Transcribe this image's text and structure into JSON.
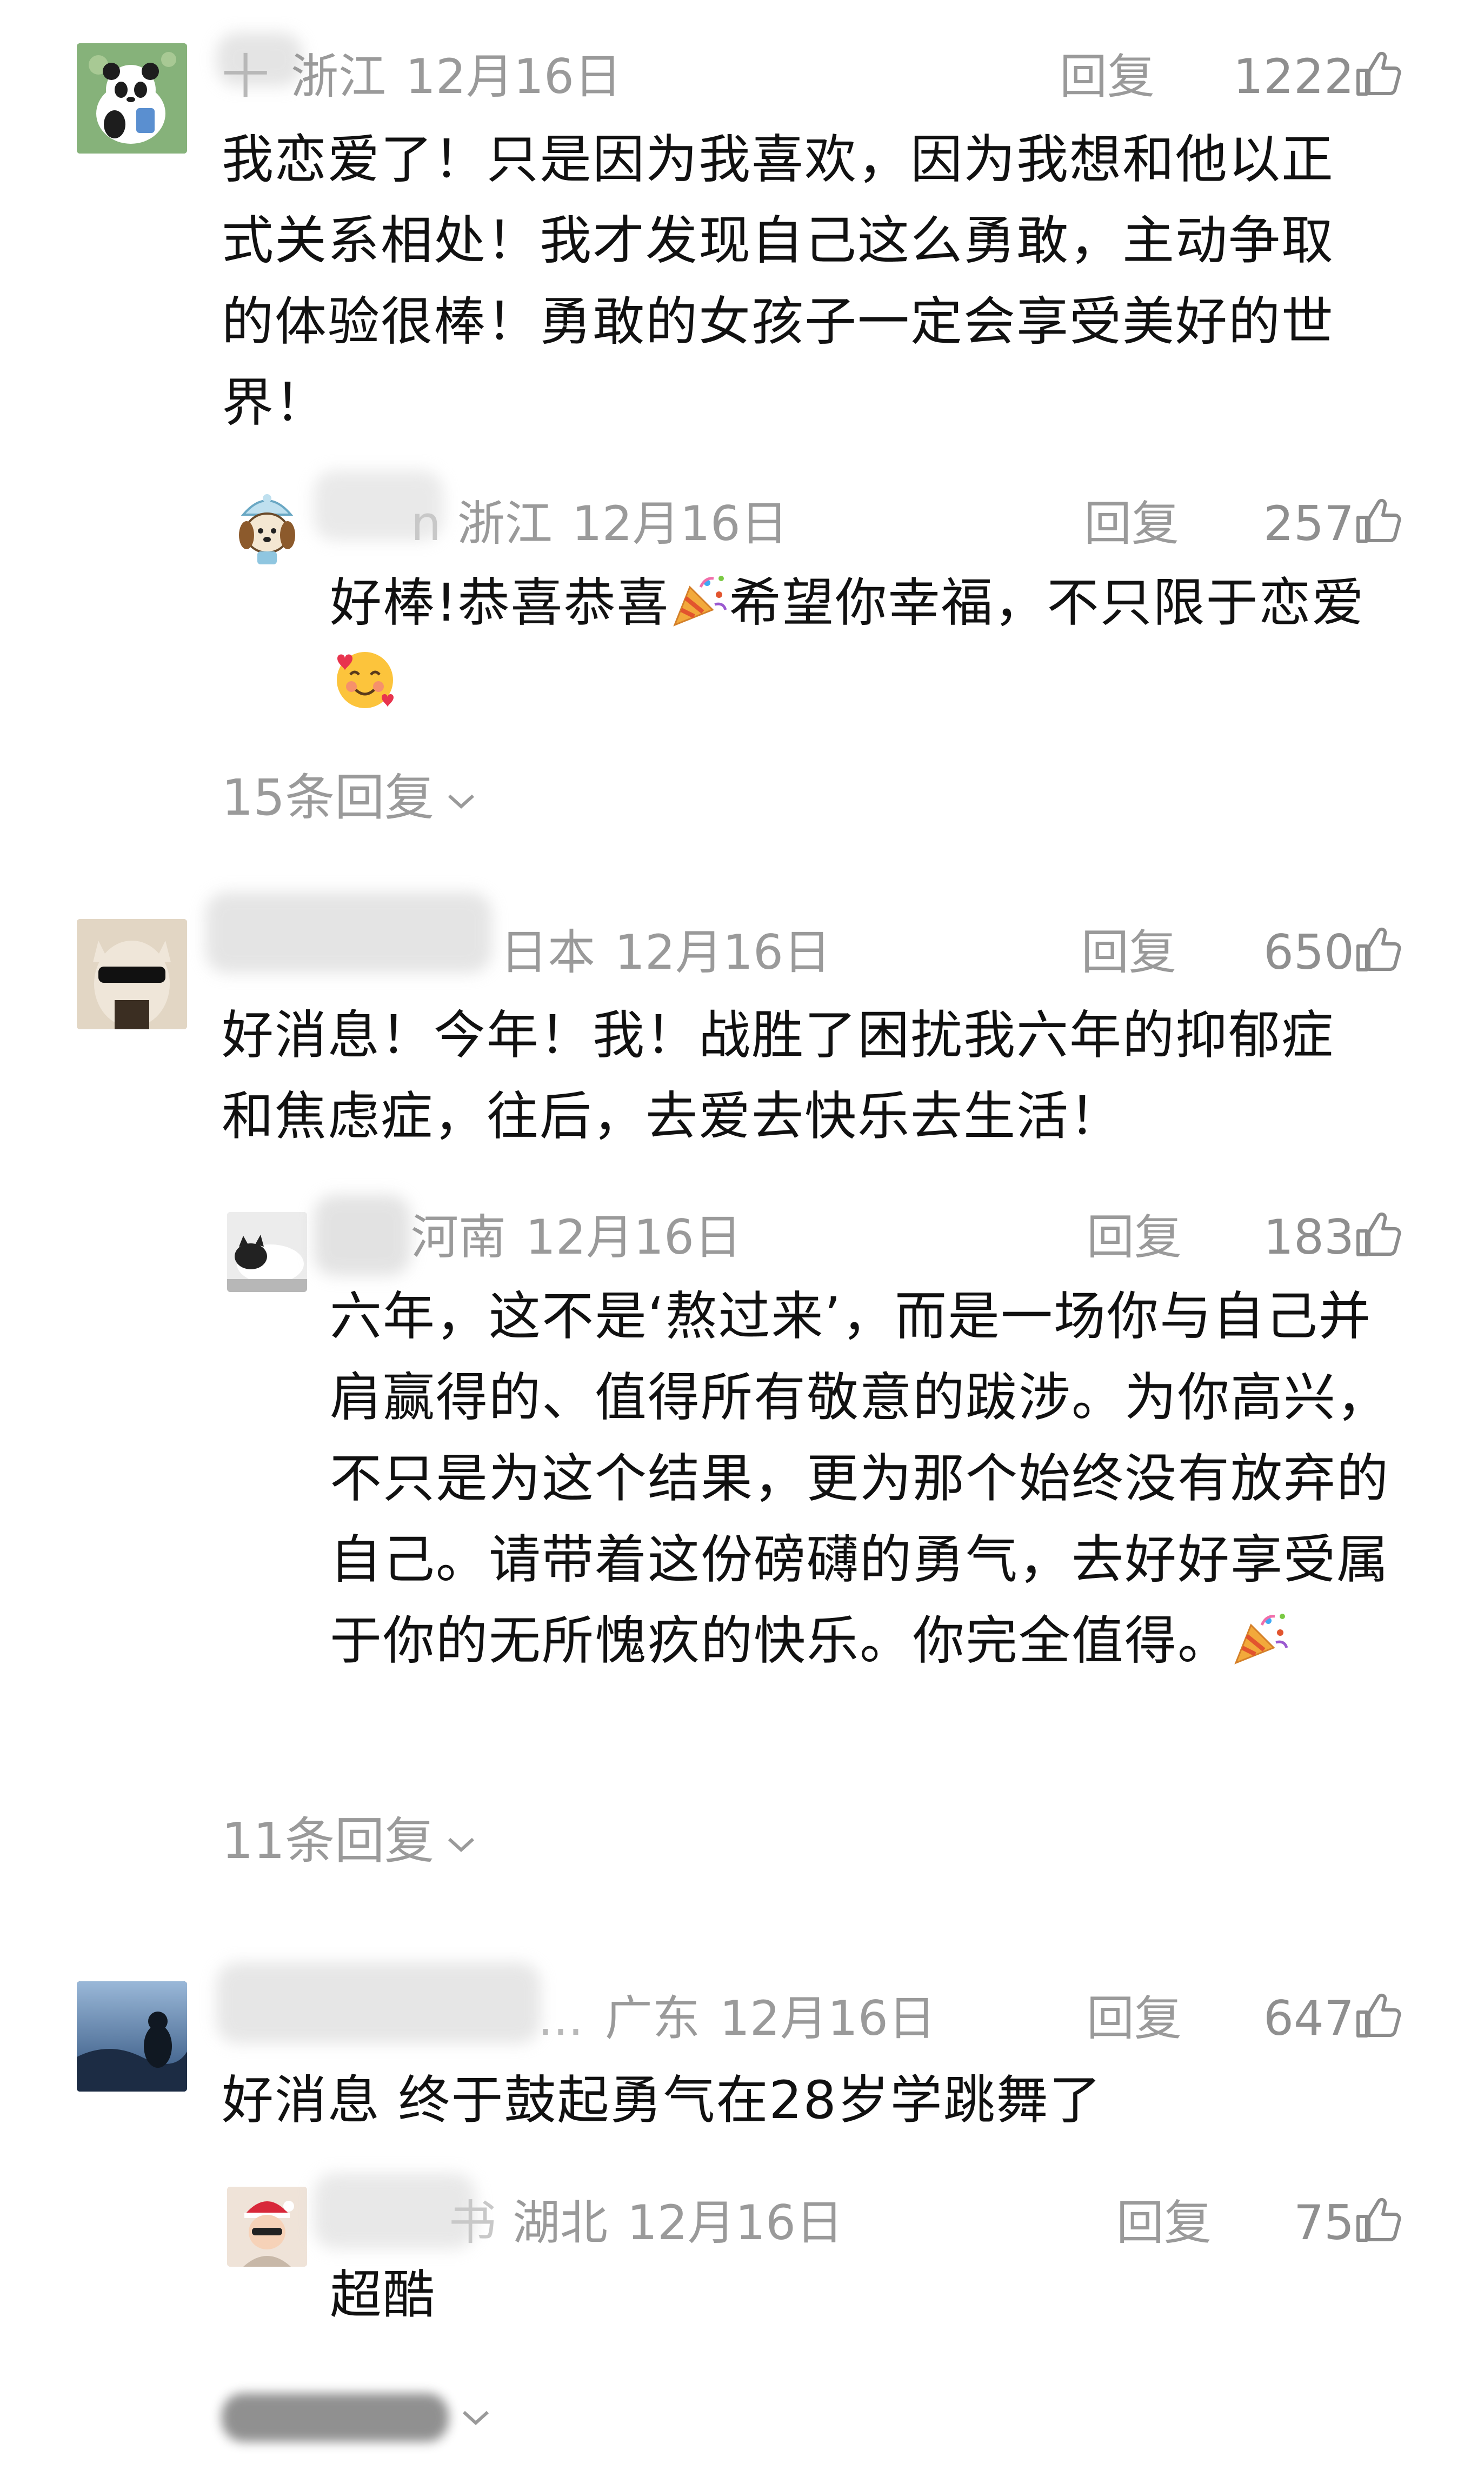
{
  "comments": [
    {
      "name_hint": "十",
      "location": "浙江",
      "date": "12月16日",
      "reply_label": "回复",
      "likes": "1222",
      "text": "我恋爱了！只是因为我喜欢，因为我想和他以正式关系相处！我才发现自己这么勇敢，主动争取的体验很棒！勇敢的女孩子一定会享受美好的世界！",
      "sub_reply": {
        "name_hint": "n",
        "location": "浙江",
        "date": "12月16日",
        "reply_label": "回复",
        "likes": "257",
        "text_before": "好棒!恭喜恭喜",
        "text_after": "希望你幸福，不只限于恋爱"
      },
      "more_replies": "15条回复"
    },
    {
      "location": "日本",
      "date": "12月16日",
      "reply_label": "回复",
      "likes": "650",
      "text": "好消息！今年！我！战胜了困扰我六年的抑郁症和焦虑症，往后，去爱去快乐去生活！",
      "sub_reply": {
        "location": "河南",
        "date": "12月16日",
        "reply_label": "回复",
        "likes": "183",
        "text": "六年，这不是‘熬过来’，而是一场你与自己并肩赢得的、值得所有敬意的跋涉。为你高兴，不只是为这个结果，更为那个始终没有放弃的自己。请带着这份磅礴的勇气，去好好享受属于你的无所愧疚的快乐。你完全值得。"
      },
      "more_replies": "11条回复"
    },
    {
      "name_hint": "...",
      "location": "广东",
      "date": "12月16日",
      "reply_label": "回复",
      "likes": "647",
      "text": "好消息 终于鼓起勇气在28岁学跳舞了",
      "sub_reply": {
        "name_hint": "书",
        "location": "湖北",
        "date": "12月16日",
        "reply_label": "回复",
        "likes": "75",
        "text": "超酷"
      }
    }
  ],
  "icons": {
    "like": "thumbs-up-icon",
    "expand": "chevron-down-icon",
    "party": "party-popper-emoji",
    "smile": "smiling-face-with-hearts-emoji"
  },
  "colors": {
    "meta_gray": "#9a9a9a",
    "text": "#111111"
  }
}
